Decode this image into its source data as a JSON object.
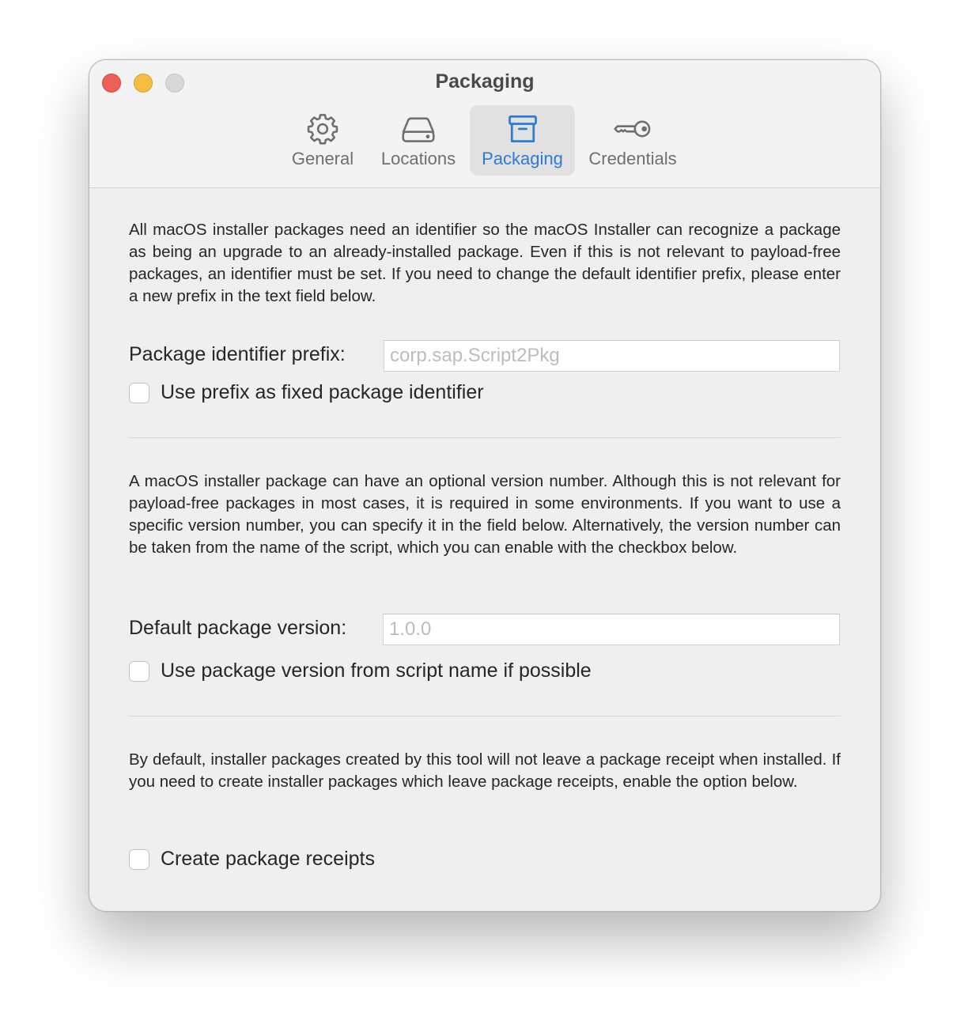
{
  "window": {
    "title": "Packaging"
  },
  "toolbar": {
    "tabs": [
      {
        "label": "General",
        "icon": "gear-icon",
        "active": false
      },
      {
        "label": "Locations",
        "icon": "drive-icon",
        "active": false
      },
      {
        "label": "Packaging",
        "icon": "archive-box-icon",
        "active": true
      },
      {
        "label": "Credentials",
        "icon": "key-icon",
        "active": false
      }
    ]
  },
  "identifier_section": {
    "description": "All macOS installer packages need an identifier so the macOS Installer can recognize a package as being an upgrade to an already-installed package. Even if this is not relevant to payload-free packages, an identifier must be set. If you need to change the default identifier prefix, please enter a new prefix in the text field below.",
    "field_label": "Package identifier prefix:",
    "field_value": "",
    "field_placeholder": "corp.sap.Script2Pkg",
    "checkbox_label": "Use prefix as fixed package identifier",
    "checkbox_checked": false
  },
  "version_section": {
    "description": "A macOS installer package can have an optional version number. Although this is not relevant for payload-free packages in most cases, it is required in some environments. If you want to use a specific version number, you can specify it in the field below. Alternatively, the version number can be taken from the name of the script, which you can enable with the checkbox below.",
    "field_label": "Default package version:",
    "field_value": "",
    "field_placeholder": "1.0.0",
    "checkbox_label": "Use package version from script name if possible",
    "checkbox_checked": false
  },
  "receipt_section": {
    "description": "By default, installer packages created by this tool will not leave a package receipt when installed. If you need to create installer packages which leave package receipts, enable the option below.",
    "checkbox_label": "Create package receipts",
    "checkbox_checked": false
  },
  "colors": {
    "accent": "#2f7bd2",
    "window_bg": "#efefef",
    "close": "#ee5f57",
    "minimize": "#f6bd3f",
    "zoom_disabled": "#d8d8d8"
  }
}
